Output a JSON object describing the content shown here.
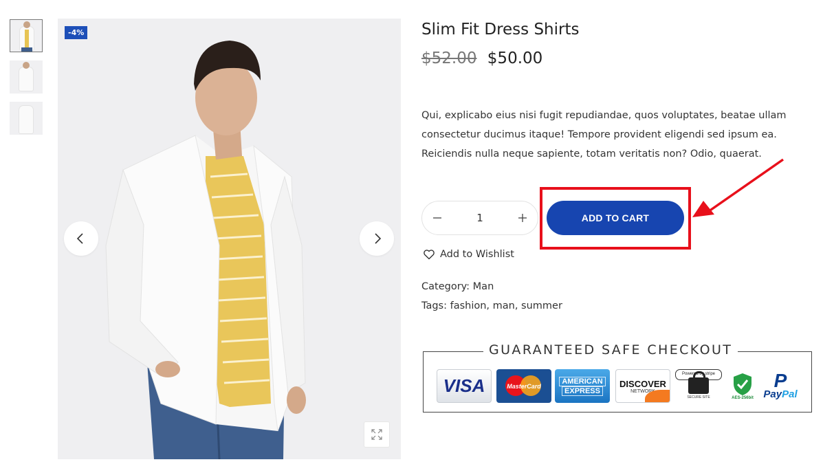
{
  "gallery": {
    "badge": "-4%",
    "thumbnails": [
      {
        "name": "thumbnail-front"
      },
      {
        "name": "thumbnail-side"
      },
      {
        "name": "thumbnail-shirt"
      }
    ],
    "icons": {
      "prev": "chevron-left-icon",
      "next": "chevron-right-icon",
      "zoom": "expand-icon"
    }
  },
  "product": {
    "title": "Slim Fit Dress Shirts",
    "old_price": "$52.00",
    "price": "$50.00",
    "description": "Qui, explicabo eius nisi fugit repudiandae, quos voluptates, beatae ullam consectetur ducimus itaque! Tempore provident eligendi sed ipsum ea. Reiciendis nulla neque sapiente, totam veritatis non? Odio, quaerat.",
    "quantity": "1",
    "add_to_cart_label": "ADD TO CART",
    "wishlist_label": "Add to Wishlist",
    "category_line": "Category: Man",
    "tags_line": "Tags: fashion, man, summer"
  },
  "checkout_badge": {
    "title": "GUARANTEED SAFE CHECKOUT",
    "visa": "VISA",
    "mastercard": "MasterCard",
    "amex_line1": "AMERICAN",
    "amex_line2": "EXPRESS",
    "discover": "DISCOVER",
    "discover_sub": "NETWORK",
    "stripe_top": "Powered by stripe",
    "stripe_bottom": "SECURE SITE",
    "aes": "AES-256bit",
    "paypal_pay": "Pay",
    "paypal_pal": "Pal",
    "paypal_p": "P"
  },
  "annotation": {
    "highlight_color": "#e8101b"
  },
  "colors": {
    "accent": "#1745b0",
    "badge": "#1d4fb8"
  }
}
